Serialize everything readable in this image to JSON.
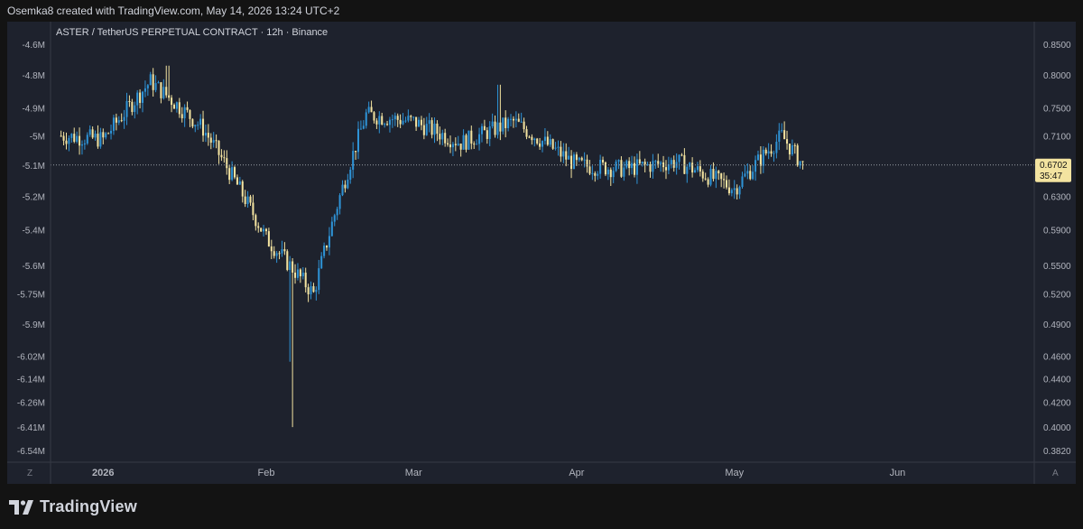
{
  "header": {
    "credit": "Osemka8 created with TradingView.com, May 14, 2026 13:24 UTC+2"
  },
  "chart": {
    "symbol_title": "ASTER / TetherUS PERPETUAL CONTRACT · 12h · Binance",
    "last_price": "0.6702",
    "countdown": "35:47",
    "left_axis_labels": [
      "-4.6M",
      "-4.8M",
      "-4.9M",
      "-5M",
      "-5.1M",
      "-5.2M",
      "-5.4M",
      "-5.6M",
      "-5.75M",
      "-5.9M",
      "-6.02M",
      "-6.14M",
      "-6.26M",
      "-6.41M",
      "-6.54M"
    ],
    "right_axis_labels": [
      "0.8500",
      "0.8000",
      "0.7500",
      "0.7100",
      "0.6700",
      "0.6300",
      "0.5900",
      "0.5500",
      "0.5200",
      "0.4900",
      "0.4600",
      "0.4400",
      "0.4200",
      "0.4000",
      "0.3820"
    ],
    "x_axis_labels": [
      "2026",
      "Feb",
      "Mar",
      "Apr",
      "May",
      "Jun"
    ],
    "left_corner": "Z",
    "right_corner": "A",
    "colors": {
      "up": "#2e93d6",
      "down": "#f3e3a0",
      "background": "#1e222d",
      "price_tag": "#f3e3a0"
    }
  },
  "chart_data": {
    "type": "candlestick",
    "interval": "12h",
    "x": [
      "2025-12-24",
      "2026-01-01",
      "2026-01-10",
      "2026-01-20",
      "2026-02-01",
      "2026-02-10",
      "2026-02-20",
      "2026-03-01",
      "2026-03-10",
      "2026-03-20",
      "2026-04-01",
      "2026-04-10",
      "2026-04-20",
      "2026-05-01",
      "2026-05-10",
      "2026-05-14"
    ],
    "close": [
      0.71,
      0.705,
      0.79,
      0.72,
      0.58,
      0.52,
      0.74,
      0.73,
      0.7,
      0.73,
      0.67,
      0.665,
      0.675,
      0.64,
      0.71,
      0.6702
    ],
    "ylim": [
      0.382,
      0.85
    ],
    "y_scale": "log",
    "grid": false
  }
}
